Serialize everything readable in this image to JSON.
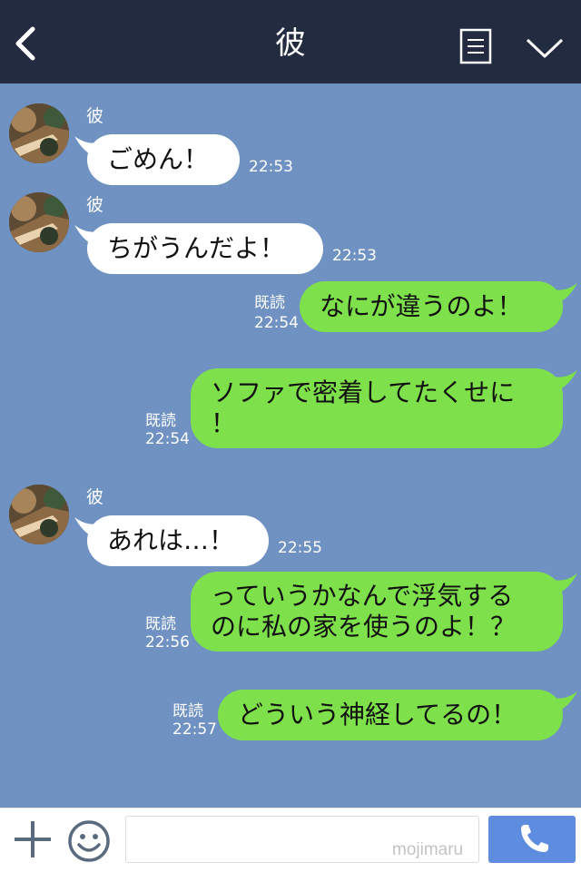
{
  "header": {
    "title": "彼",
    "back_icon": "chevron-left-icon",
    "notes_icon": "notes-icon",
    "menu_icon": "chevron-down-icon"
  },
  "messages": [
    {
      "side": "in",
      "sender": "彼",
      "text": "ごめん！",
      "time": "22:53"
    },
    {
      "side": "in",
      "sender": "彼",
      "text": "ちがうんだよ！",
      "time": "22:53"
    },
    {
      "side": "out",
      "read": "既読",
      "text": "なにが違うのよ！",
      "time": "22:54"
    },
    {
      "side": "out",
      "read": "既読",
      "line1": "ソファで密着してたくせに",
      "line2": "！",
      "time": "22:54"
    },
    {
      "side": "in",
      "sender": "彼",
      "text": "あれは…！",
      "time": "22:55"
    },
    {
      "side": "out",
      "read": "既読",
      "line1": "っていうかなんで浮気する",
      "line2": "のに私の家を使うのよ！？",
      "time": "22:56"
    },
    {
      "side": "out",
      "read": "既読",
      "text": "どういう神経してるの！",
      "time": "22:57"
    }
  ],
  "footer": {
    "input_value": "",
    "watermark": "mojimaru",
    "plus_icon": "plus-icon",
    "emoji_icon": "smiley-icon",
    "call_icon": "phone-icon"
  },
  "colors": {
    "header_bg": "#232b40",
    "chat_bg": "#6f92c2",
    "incoming_bubble": "#ffffff",
    "outgoing_bubble": "#7ee04a",
    "call_button": "#5e8de0"
  }
}
